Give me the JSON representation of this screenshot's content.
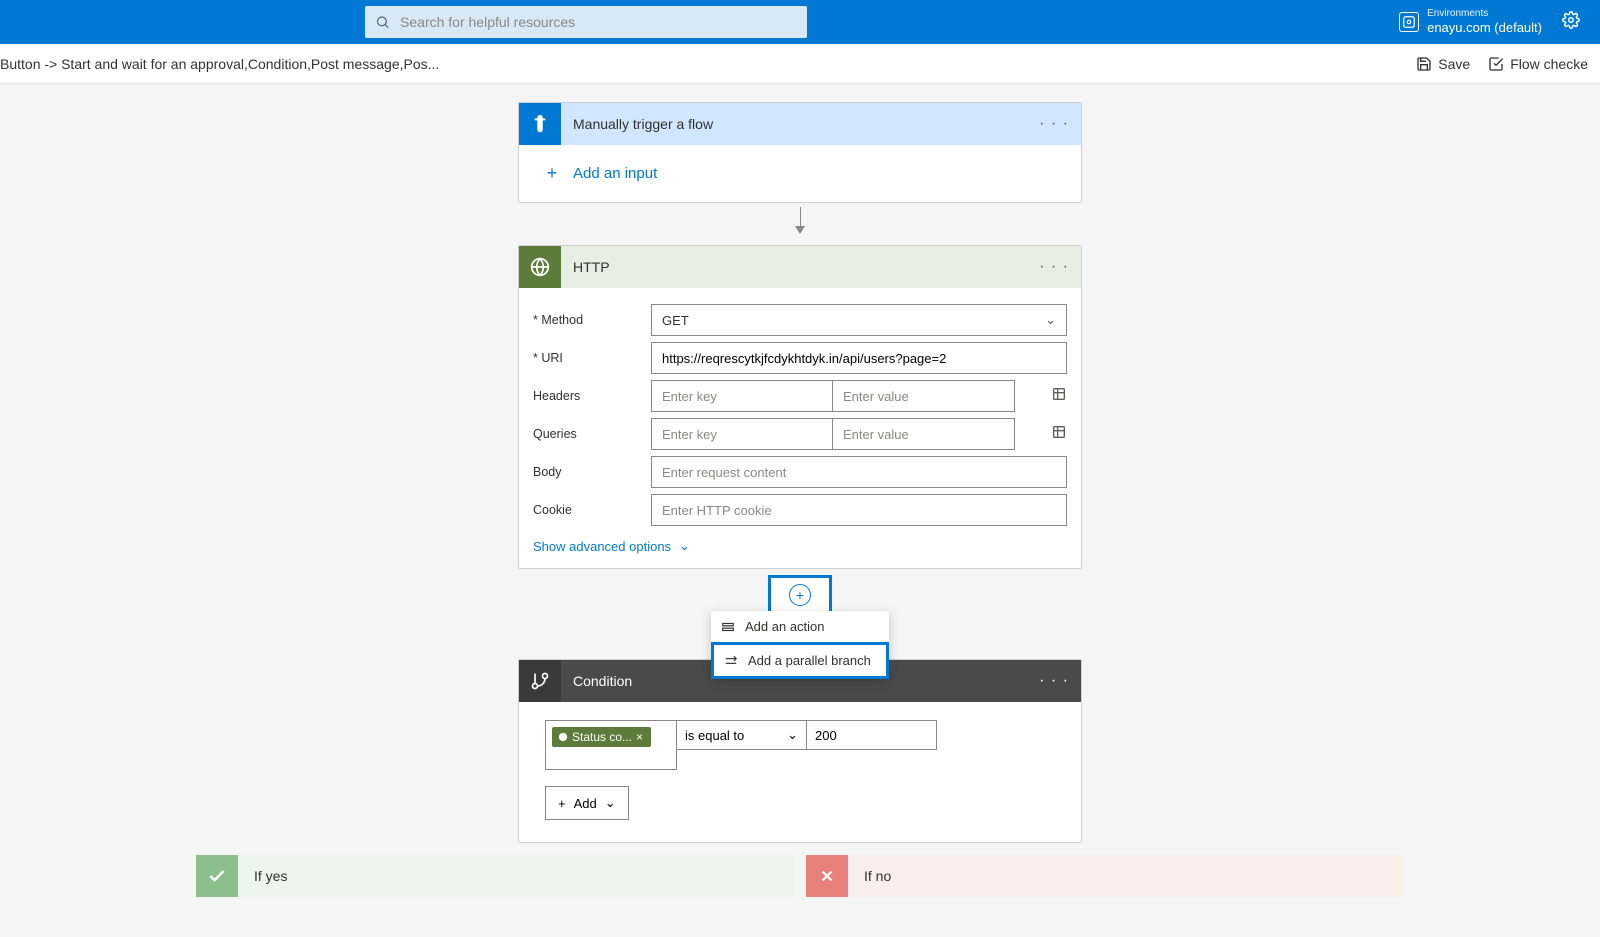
{
  "topbar": {
    "search_placeholder": "Search for helpful resources",
    "env_label": "Environments",
    "env_name": "enayu.com (default)"
  },
  "crumb": {
    "text": "Button -> Start and wait for an approval,Condition,Post message,Pos...",
    "save": "Save",
    "flow_checker": "Flow checke"
  },
  "trigger": {
    "title": "Manually trigger a flow",
    "add_input": "Add an input"
  },
  "http": {
    "title": "HTTP",
    "method_label": "Method",
    "method_value": "GET",
    "uri_label": "URI",
    "uri_value": "https://reqrescytkjfcdykhtdyk.in/api/users?page=2",
    "headers_label": "Headers",
    "queries_label": "Queries",
    "key_ph": "Enter key",
    "value_ph": "Enter value",
    "body_label": "Body",
    "body_ph": "Enter request content",
    "cookie_label": "Cookie",
    "cookie_ph": "Enter HTTP cookie",
    "adv": "Show advanced options"
  },
  "popup": {
    "add_action": "Add an action",
    "add_parallel": "Add a parallel branch"
  },
  "condition": {
    "title": "Condition",
    "token": "Status co...",
    "operator": "is equal to",
    "value": "200",
    "add": "Add"
  },
  "branches": {
    "yes": "If yes",
    "no": "If no"
  }
}
